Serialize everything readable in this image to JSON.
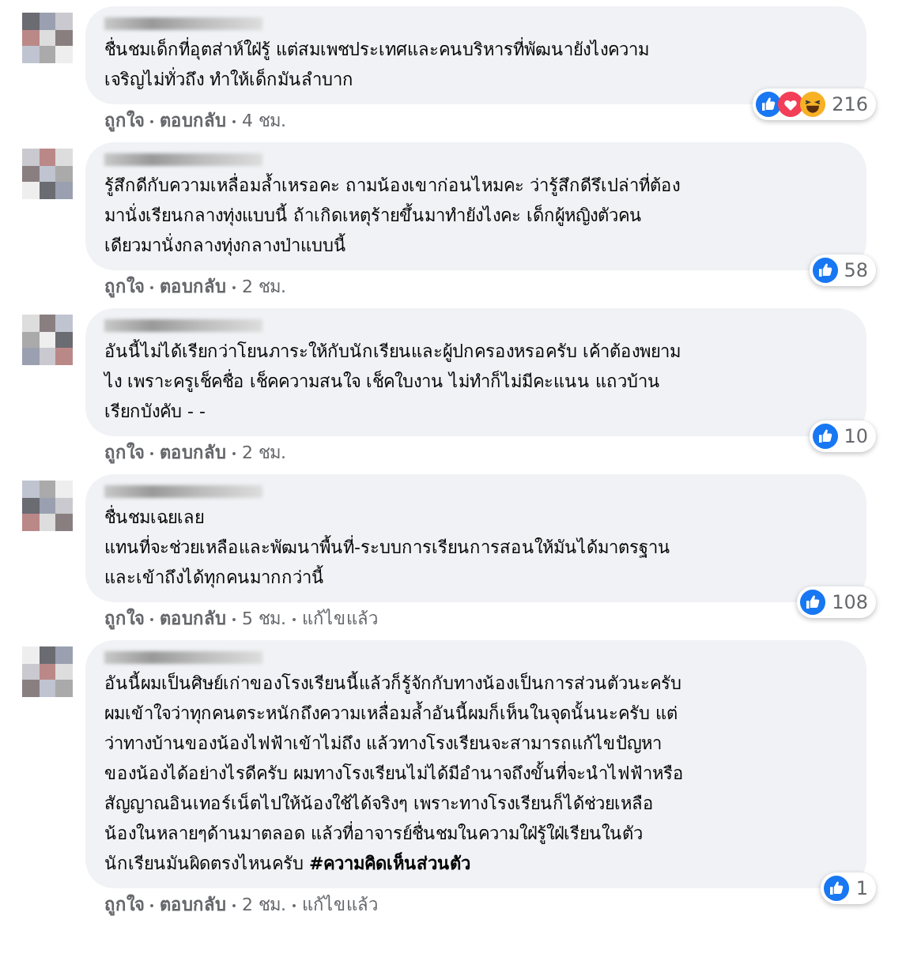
{
  "comments": [
    {
      "text": "ชื่นชมเด็กที่อุตส่าห์ใฝ่รู้ แต่สมเพชประเทศและคนบริหารที่พัฒนายังไงความ\nเจริญไม่ทั่วถึง ทำให้เด็กมันลำบาก",
      "reactions": [
        {
          "kind": "like"
        },
        {
          "kind": "love"
        },
        {
          "kind": "haha"
        }
      ],
      "reaction_count": "216",
      "actions": [
        "ถูกใจ",
        "ตอบกลับ"
      ],
      "time": "4 ชม."
    },
    {
      "text": "รู้สึกดีกับความเหลื่อมล้ำเหรอคะ ถามน้องเขาก่อนไหมคะ ว่ารู้สึกดีรึเปล่าที่ต้อง\nมานั่งเรียนกลางทุ่งแบบนี้ ถ้าเกิดเหตุร้ายขึ้นมาทำยังไงคะ เด็กผู้หญิงตัวคน\nเดียวมานั่งกลางทุ่งกลางป่าแบบนี้",
      "reactions": [
        {
          "kind": "like"
        }
      ],
      "reaction_count": "58",
      "actions": [
        "ถูกใจ",
        "ตอบกลับ"
      ],
      "time": "2 ชม."
    },
    {
      "text": "อันนี้ไม่ได้เรียกว่าโยนภาระให้กับนักเรียนและผู้ปกครองหรอครับ เค้าต้องพยาม\nไง เพราะครูเช็คชื่อ เช็คความสนใจ เช็คใบงาน ไม่ทำก็ไม่มีคะแนน แถวบ้าน\nเรียกบังคับ - -",
      "reactions": [
        {
          "kind": "like"
        }
      ],
      "reaction_count": "10",
      "actions": [
        "ถูกใจ",
        "ตอบกลับ"
      ],
      "time": "2 ชม."
    },
    {
      "text": "ชื่นชมเฉยเลย\nแทนที่จะช่วยเหลือและพัฒนาพื้นที่-ระบบการเรียนการสอนให้มันได้มาตรฐาน\nและเข้าถึงได้ทุกคนมากกว่านี้",
      "reactions": [
        {
          "kind": "like"
        }
      ],
      "reaction_count": "108",
      "actions": [
        "ถูกใจ",
        "ตอบกลับ"
      ],
      "time": "5 ชม.",
      "edited_label": "แก้ไขแล้ว"
    },
    {
      "text": "อันนี้ผมเป็นศิษย์เก่าของโรงเรียนนี้แล้วก็รู้จักกับทางน้องเป็นการส่วนตัวนะครับ\nผมเข้าใจว่าทุกคนตระหนักถึงความเหลื่อมล้ำอันนี้ผมก็เห็นในจุดนั้นนะครับ แต่\nว่าทางบ้านของน้องไฟฟ้าเข้าไม่ถึง แล้วทางโรงเรียนจะสามารถแก้ไขปัญหา\nของน้องได้อย่างไรดีครับ ผมทางโรงเรียนไม่ได้มีอำนาจถึงขั้นที่จะนำไฟฟ้าหรือ\nสัญญาณอินเทอร์เน็ตไปให้น้องใช้ได้จริงๆ เพราะทางโรงเรียนก็ได้ช่วยเหลือ\nน้องในหลายๆด้านมาตลอด แล้วที่อาจารย์ชื่นชมในความใฝ่รู้ใฝ่เรียนในตัว\nนักเรียนมันผิดตรงไหนครับ **#ความคิดเห็นส่วนตัว**",
      "reactions": [
        {
          "kind": "like"
        }
      ],
      "reaction_count": "1",
      "actions": [
        "ถูกใจ",
        "ตอบกลับ"
      ],
      "time": "2 ชม.",
      "edited_label": "แก้ไขแล้ว"
    }
  ]
}
